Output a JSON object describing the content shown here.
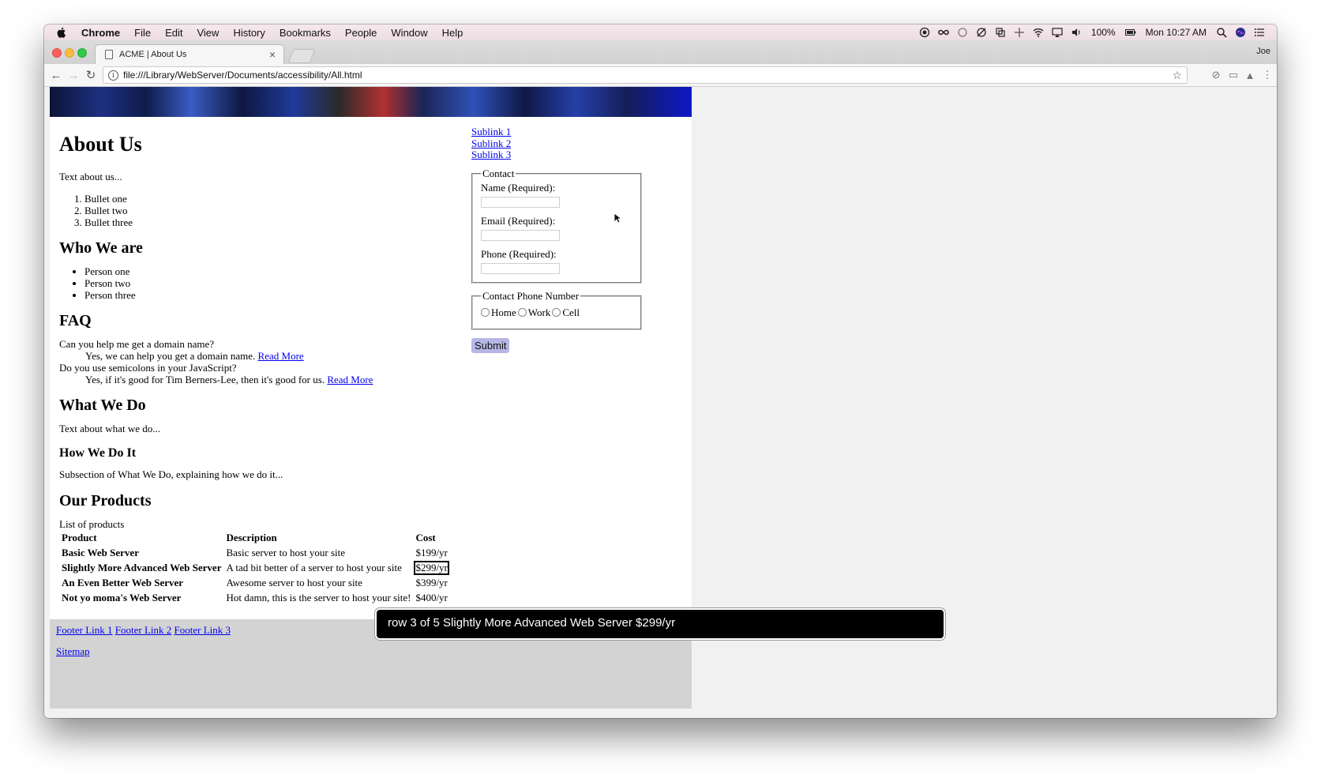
{
  "menubar": {
    "app": "Chrome",
    "items": [
      "File",
      "Edit",
      "View",
      "History",
      "Bookmarks",
      "People",
      "Window",
      "Help"
    ],
    "battery": "100%",
    "clock": "Mon 10:27 AM"
  },
  "browser": {
    "tab_title": "ACME | About Us",
    "profile": "Joe",
    "url": "file:///Library/WebServer/Documents/accessibility/All.html"
  },
  "page": {
    "about_heading": "About Us",
    "about_text": "Text about us...",
    "bullets": [
      "Bullet one",
      "Bullet two",
      "Bullet three"
    ],
    "who_heading": "Who We are",
    "persons": [
      "Person one",
      "Person two",
      "Person three"
    ],
    "faq_heading": "FAQ",
    "faq": [
      {
        "q": "Can you help me get a domain name?",
        "a": "Yes, we can help you get a domain name.",
        "link": "Read More"
      },
      {
        "q": "Do you use semicolons in your JavaScript?",
        "a": "Yes, if it's good for Tim Berners-Lee, then it's good for us.",
        "link": "Read More"
      }
    ],
    "what_heading": "What We Do",
    "what_text": "Text about what we do...",
    "how_heading": "How We Do It",
    "how_text": "Subsection of What We Do, explaining how we do it...",
    "products_heading": "Our Products",
    "products_caption": "List of products",
    "products_headers": [
      "Product",
      "Description",
      "Cost"
    ],
    "products_rows": [
      [
        "Basic Web Server",
        "Basic server to host your site",
        "$199/yr"
      ],
      [
        "Slightly More Advanced Web Server",
        "A tad bit better of a server to host your site",
        "$299/yr"
      ],
      [
        "An Even Better Web Server",
        "Awesome server to host your site",
        "$399/yr"
      ],
      [
        "Not yo moma's Web Server",
        "Hot damn, this is the server to host your site!",
        "$400/yr"
      ]
    ]
  },
  "sidebar": {
    "sublinks": [
      "Sublink 1",
      "Sublink 2",
      "Sublink 3"
    ],
    "contact_legend": "Contact",
    "name_label": "Name (Required):",
    "email_label": "Email (Required):",
    "phone_label": "Phone (Required):",
    "phone_type_legend": "Contact Phone Number",
    "phone_options": [
      "Home",
      "Work",
      "Cell"
    ],
    "submit_label": "Submit"
  },
  "footer": {
    "links": [
      "Footer Link 1",
      "Footer Link 2",
      "Footer Link 3"
    ],
    "sitemap": "Sitemap"
  },
  "voiceover_caption": "row 3 of 5 Slightly More Advanced Web Server $299/yr"
}
